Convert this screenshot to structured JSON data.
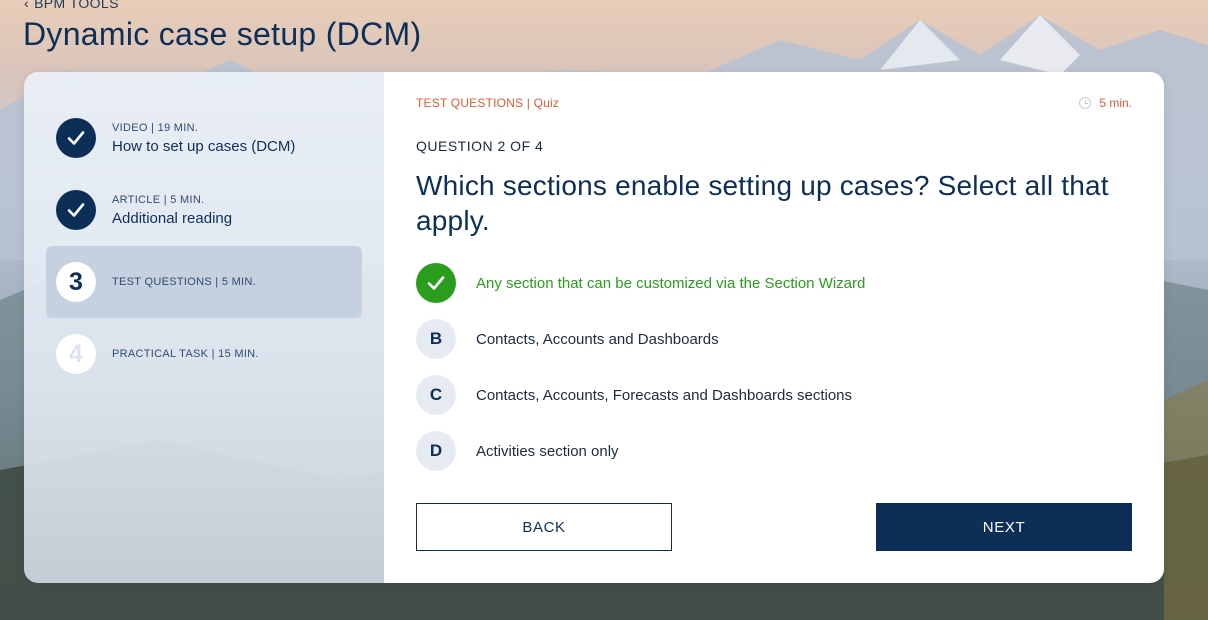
{
  "header": {
    "back_label": "BPM TOOLS",
    "title": "Dynamic case setup (DCM)"
  },
  "sidebar": {
    "steps": [
      {
        "status": "done",
        "badge": "",
        "meta": "VIDEO | 19 MIN.",
        "title": "How to set up cases (DCM)"
      },
      {
        "status": "done",
        "badge": "",
        "meta": "ARTICLE | 5 MIN.",
        "title": "Additional reading"
      },
      {
        "status": "current",
        "badge": "3",
        "meta": "TEST QUESTIONS | 5 MIN.",
        "title": ""
      },
      {
        "status": "pending",
        "badge": "4",
        "meta": "PRACTICAL TASK | 15 MIN.",
        "title": ""
      }
    ]
  },
  "quiz": {
    "crumb": "TEST QUESTIONS | Quiz",
    "duration": "5 min.",
    "counter": "QUESTION 2 OF 4",
    "question": "Which sections enable setting up cases? Select all that apply.",
    "options": [
      {
        "letter": "",
        "label": "Any section that can be customized via the Section Wizard",
        "selected": true
      },
      {
        "letter": "B",
        "label": "Contacts, Accounts and Dashboards",
        "selected": false
      },
      {
        "letter": "C",
        "label": "Contacts, Accounts, Forecasts and Dashboards sections",
        "selected": false
      },
      {
        "letter": "D",
        "label": "Activities section only",
        "selected": false
      }
    ],
    "back_button": "BACK",
    "next_button": "NEXT"
  },
  "colors": {
    "primary": "#0d2f57",
    "accent": "#e4572e",
    "correct": "#2a9d1e"
  }
}
